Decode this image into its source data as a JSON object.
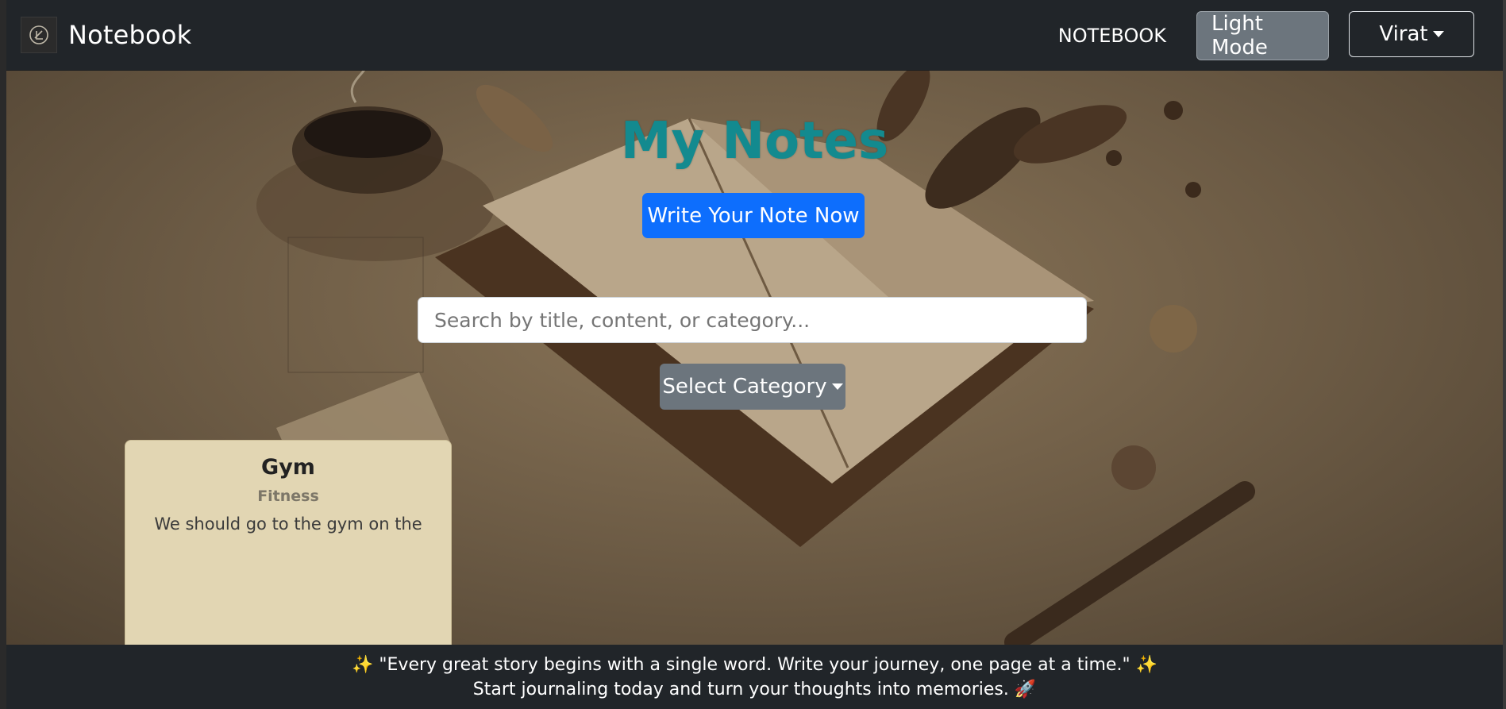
{
  "navbar": {
    "brand": "Notebook",
    "brand_icon": "notebook-logo-icon",
    "nav_link": "NOTEBOOK",
    "theme_button": "Light Mode",
    "user_menu": "Virat"
  },
  "hero": {
    "title": "My Notes",
    "write_button": "Write Your Note Now",
    "search": {
      "placeholder": "Search by title, content, or category...",
      "value": ""
    },
    "category_button": "Select Category"
  },
  "notes": [
    {
      "title": "Gym",
      "category": "Fitness",
      "content": "We should go to the gym on the"
    }
  ],
  "footer": {
    "line1": "✨ \"Every great story begins with a single word. Write your journey, one page at a time.\" ✨",
    "line2": "Start journaling today and turn your thoughts into memories. 🚀"
  },
  "colors": {
    "navbar_bg": "#212529",
    "title": "#138a8f",
    "primary": "#0d6efd",
    "secondary": "#6c757d",
    "card_bg": "#e2d6b3"
  }
}
